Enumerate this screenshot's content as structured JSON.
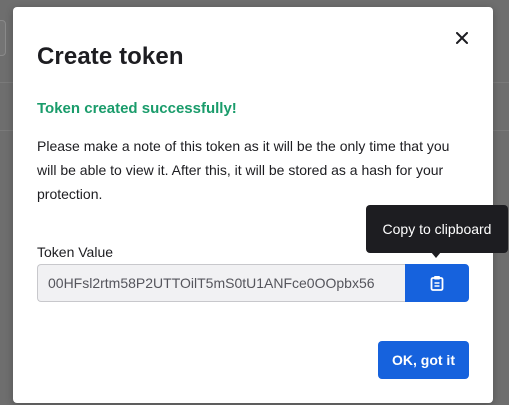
{
  "modal": {
    "title": "Create token",
    "success_message": "Token created successfully!",
    "description": "Please make a note of this token as it will be the only time that you will be able to view it. After this, it will be stored as a hash for your protection.",
    "close_icon": "close-icon",
    "token": {
      "label": "Token Value",
      "value": "00HFsl2rtm58P2UTTOilT5mS0tU1ANFce0OOpbx56"
    },
    "copy_button": {
      "icon": "clipboard-icon",
      "tooltip": "Copy to clipboard"
    },
    "confirm_label": "OK, got it"
  },
  "colors": {
    "success": "#1a9c6b",
    "primary": "#1662dd",
    "text": "#1d1d21",
    "tooltip_bg": "#1d1d21",
    "overlay": "#6e6e6e"
  }
}
